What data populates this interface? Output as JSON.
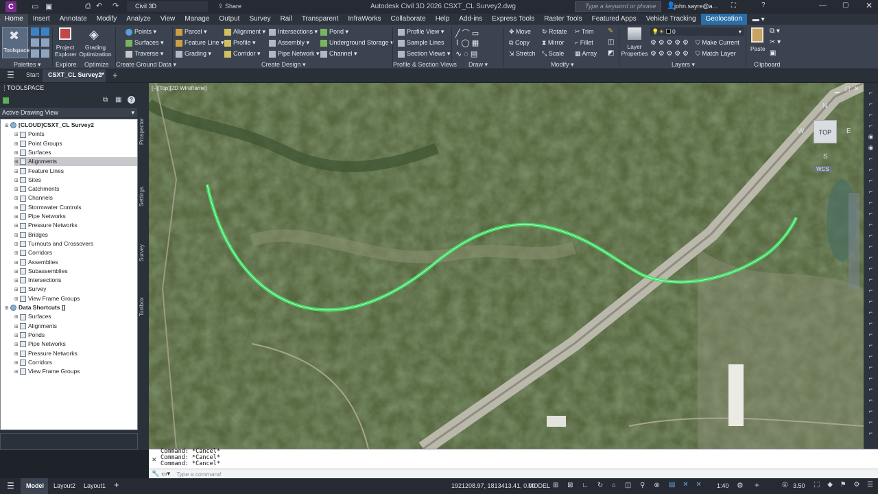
{
  "titlebar": {
    "app_letter": "C",
    "workspace": "Civil 3D",
    "share_label": "Share",
    "title": "Autodesk Civil 3D 2026   CSXT_CL Survey2.dwg",
    "search_placeholder": "Type a keyword or phrase",
    "user": "john.sayre@a..."
  },
  "menu": {
    "tabs": [
      "Home",
      "Insert",
      "Annotate",
      "Modify",
      "Analyze",
      "View",
      "Manage",
      "Output",
      "Survey",
      "Rail",
      "Transparent",
      "InfraWorks",
      "Collaborate",
      "Help",
      "Add-ins",
      "Express Tools",
      "Raster Tools",
      "Featured Apps",
      "Vehicle Tracking",
      "Geolocation"
    ]
  },
  "ribbon": {
    "toolspace": "Toolspace",
    "project_explorer": "Project Explorer",
    "grading_optimization": "Grading Optimization",
    "points": "Points",
    "surfaces": "Surfaces",
    "traverse": "Traverse",
    "parcel": "Parcel",
    "feature_line": "Feature Line",
    "grading": "Grading",
    "alignment": "Alignment",
    "profile": "Profile",
    "corridor": "Corridor",
    "intersections": "Intersections",
    "assembly": "Assembly",
    "pipe_network": "Pipe Network",
    "pond": "Pond",
    "underground_storage": "Underground Storage",
    "channel": "Channel",
    "profile_view": "Profile View",
    "sample_lines": "Sample Lines",
    "section_views": "Section Views",
    "move": "Move",
    "copy": "Copy",
    "stretch": "Stretch",
    "rotate": "Rotate",
    "mirror": "Mirror",
    "scale": "Scale",
    "trim": "Trim",
    "fillet": "Fillet",
    "array": "Array",
    "layer_properties": "Layer Properties",
    "make_current": "Make Current",
    "match_layer": "Match Layer",
    "layer_value": "0",
    "paste": "Paste",
    "panels": {
      "palettes": "Palettes",
      "explore": "Explore",
      "optimize": "Optimize",
      "create_ground_data": "Create Ground Data",
      "create_design": "Create Design",
      "profile_section_views": "Profile & Section Views",
      "draw": "Draw",
      "modify": "Modify",
      "layers": "Layers",
      "clipboard": "Clipboard"
    }
  },
  "doctabs": {
    "start": "Start",
    "active": "CSXT_CL Survey2*"
  },
  "toolspace": {
    "title": "TOOLSPACE",
    "view": "Active Drawing View",
    "side_tabs": [
      "Prospector",
      "Settings",
      "Survey",
      "Toolbox"
    ],
    "tree": [
      {
        "label": "[CLOUD]CSXT_CL Survey2",
        "level": 0
      },
      {
        "label": "Points",
        "level": 1
      },
      {
        "label": "Point Groups",
        "level": 1
      },
      {
        "label": "Surfaces",
        "level": 1
      },
      {
        "label": "Alignments",
        "level": 1,
        "selected": true
      },
      {
        "label": "Feature Lines",
        "level": 1
      },
      {
        "label": "Sites",
        "level": 1
      },
      {
        "label": "Catchments",
        "level": 1
      },
      {
        "label": "Channels",
        "level": 1
      },
      {
        "label": "Stormwater Controls",
        "level": 1
      },
      {
        "label": "Pipe Networks",
        "level": 1
      },
      {
        "label": "Pressure Networks",
        "level": 1
      },
      {
        "label": "Bridges",
        "level": 1
      },
      {
        "label": "Turnouts and Crossovers",
        "level": 1
      },
      {
        "label": "Corridors",
        "level": 1
      },
      {
        "label": "Assemblies",
        "level": 1
      },
      {
        "label": "Subassemblies",
        "level": 1
      },
      {
        "label": "Intersections",
        "level": 1
      },
      {
        "label": "Survey",
        "level": 1
      },
      {
        "label": "View Frame Groups",
        "level": 1
      },
      {
        "label": "Data Shortcuts []",
        "level": 0
      },
      {
        "label": "Surfaces",
        "level": 1
      },
      {
        "label": "Alignments",
        "level": 1
      },
      {
        "label": "Ponds",
        "level": 1
      },
      {
        "label": "Pipe Networks",
        "level": 1
      },
      {
        "label": "Pressure Networks",
        "level": 1
      },
      {
        "label": "Corridors",
        "level": 1
      },
      {
        "label": "View Frame Groups",
        "level": 1
      }
    ]
  },
  "viewport": {
    "label": "[−][Top][2D Wireframe]",
    "viewcube_top": "TOP",
    "compass": {
      "n": "N",
      "w": "W",
      "e": "E",
      "s": "S"
    },
    "wcs": "WCS"
  },
  "command": {
    "history": [
      "Command: *Cancel*",
      "Command: *Cancel*",
      "Command: *Cancel*"
    ],
    "placeholder": "Type a command"
  },
  "status": {
    "tabs": [
      "Model",
      "Layout2",
      "Layout1"
    ],
    "coords": "1921208.97, 1813413.41, 0.00",
    "mode": "MODEL",
    "scale": "1:40",
    "value": "3.50"
  },
  "colors": {
    "alignment": "#3ee86a",
    "accent": "#2a6ea6",
    "ribbon": "#3b4350"
  }
}
